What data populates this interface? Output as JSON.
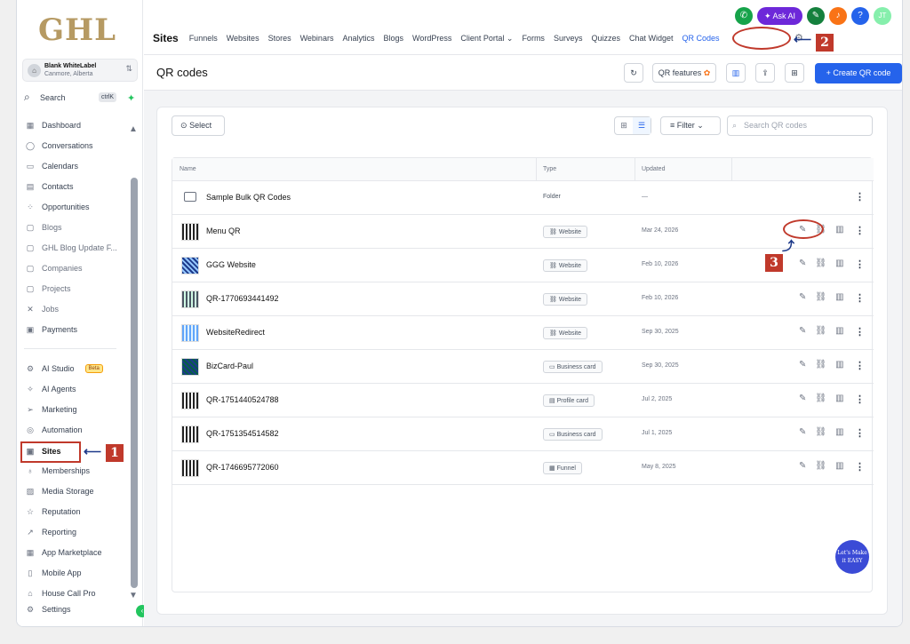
{
  "brand": {
    "logo": "GHL"
  },
  "account": {
    "name": "Blank WhiteLabel",
    "location": "Canmore, Alberta"
  },
  "search": {
    "label": "Search",
    "shortcut": "ctrlK"
  },
  "sidebar": {
    "items": [
      {
        "label": "Dashboard"
      },
      {
        "label": "Conversations"
      },
      {
        "label": "Calendars"
      },
      {
        "label": "Contacts"
      },
      {
        "label": "Opportunities"
      },
      {
        "label": "Blogs"
      },
      {
        "label": "GHL Blog Update F..."
      },
      {
        "label": "Companies"
      },
      {
        "label": "Projects"
      },
      {
        "label": "Jobs"
      },
      {
        "label": "Payments"
      }
    ],
    "items2": [
      {
        "label": "AI Studio",
        "badge": "Beta"
      },
      {
        "label": "AI Agents"
      },
      {
        "label": "Marketing"
      },
      {
        "label": "Automation"
      },
      {
        "label": "Sites"
      },
      {
        "label": "Memberships"
      },
      {
        "label": "Media Storage"
      },
      {
        "label": "Reputation"
      },
      {
        "label": "Reporting"
      },
      {
        "label": "App Marketplace"
      },
      {
        "label": "Mobile App"
      },
      {
        "label": "House Call Pro"
      },
      {
        "label": "Settings"
      }
    ]
  },
  "topbar": {
    "ask_ai": "Ask AI",
    "avatar": "JT",
    "section": "Sites",
    "tabs": [
      "Funnels",
      "Websites",
      "Stores",
      "Webinars",
      "Analytics",
      "Blogs",
      "WordPress",
      "Client Portal",
      "Forms",
      "Surveys",
      "Quizzes",
      "Chat Widget",
      "QR Codes"
    ]
  },
  "page": {
    "title": "QR codes",
    "qr_features": "QR features",
    "create": "+ Create QR code"
  },
  "toolbar": {
    "select": "Select",
    "filter": "Filter",
    "search_placeholder": "Search QR codes"
  },
  "table": {
    "headers": [
      "Name",
      "Type",
      "Updated"
    ],
    "rows": [
      {
        "name": "Sample Bulk QR Codes",
        "type": "Folder",
        "updated": "—"
      },
      {
        "name": "Menu QR",
        "type": "Website",
        "updated": "Mar 24, 2026"
      },
      {
        "name": "GGG Website",
        "type": "Website",
        "updated": "Feb 10, 2026"
      },
      {
        "name": "QR-1770693441492",
        "type": "Website",
        "updated": "Feb 10, 2026"
      },
      {
        "name": "WebsiteRedirect",
        "type": "Website",
        "updated": "Sep 30, 2025"
      },
      {
        "name": "BizCard-Paul",
        "type": "Business card",
        "updated": "Sep 30, 2025"
      },
      {
        "name": "QR-1751440524788",
        "type": "Profile card",
        "updated": "Jul 2, 2025"
      },
      {
        "name": "QR-1751354514582",
        "type": "Business card",
        "updated": "Jul 1, 2025"
      },
      {
        "name": "QR-1746695772060",
        "type": "Funnel",
        "updated": "May 8, 2025"
      }
    ]
  },
  "annotations": {
    "b1": "1",
    "b2": "2",
    "b3": "3"
  },
  "watermark": "Let's Make it EASY",
  "colors": {
    "accent": "#2563eb",
    "annotation": "#c0392b",
    "brand": "#b69a63"
  }
}
